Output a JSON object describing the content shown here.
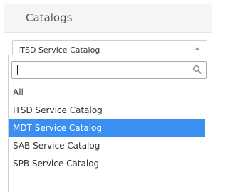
{
  "panel": {
    "title": "Catalogs"
  },
  "select": {
    "value": "ITSD Service Catalog"
  },
  "search": {
    "value": "",
    "placeholder": ""
  },
  "options": [
    {
      "label": "All",
      "selected": false
    },
    {
      "label": "ITSD Service Catalog",
      "selected": false
    },
    {
      "label": "MDT Service Catalog",
      "selected": true
    },
    {
      "label": "SAB Service Catalog",
      "selected": false
    },
    {
      "label": "SPB Service Catalog",
      "selected": false
    }
  ],
  "colors": {
    "highlight": "#3b8ff0",
    "header_bg": "#f5f5f5",
    "border": "#cfcfcf"
  },
  "icons": {
    "search": "search-icon",
    "arrow": "chevron-up-icon"
  }
}
